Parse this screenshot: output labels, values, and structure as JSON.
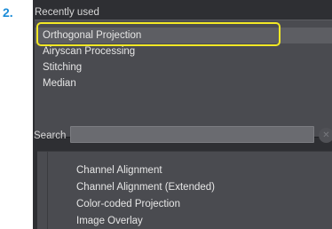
{
  "step": {
    "number": "2."
  },
  "recent": {
    "title": "Recently used",
    "items": [
      {
        "label": "Orthogonal Projection",
        "selected": true
      },
      {
        "label": "Airyscan Processing",
        "selected": false
      },
      {
        "label": "Stitching",
        "selected": false
      },
      {
        "label": "Median",
        "selected": false
      }
    ]
  },
  "search": {
    "label": "Search",
    "value": "",
    "clear_icon": "close-circle-icon"
  },
  "functions": {
    "items": [
      {
        "label": "Channel Alignment"
      },
      {
        "label": "Channel Alignment (Extended)"
      },
      {
        "label": "Color-coded Projection"
      },
      {
        "label": "Image Overlay"
      }
    ]
  },
  "colors": {
    "panel_bg": "#2e2f33",
    "list_bg": "#4a4b50",
    "selected_bg": "#5d5e63",
    "highlight": "#f2e825",
    "step_number": "#1b8cd8"
  }
}
